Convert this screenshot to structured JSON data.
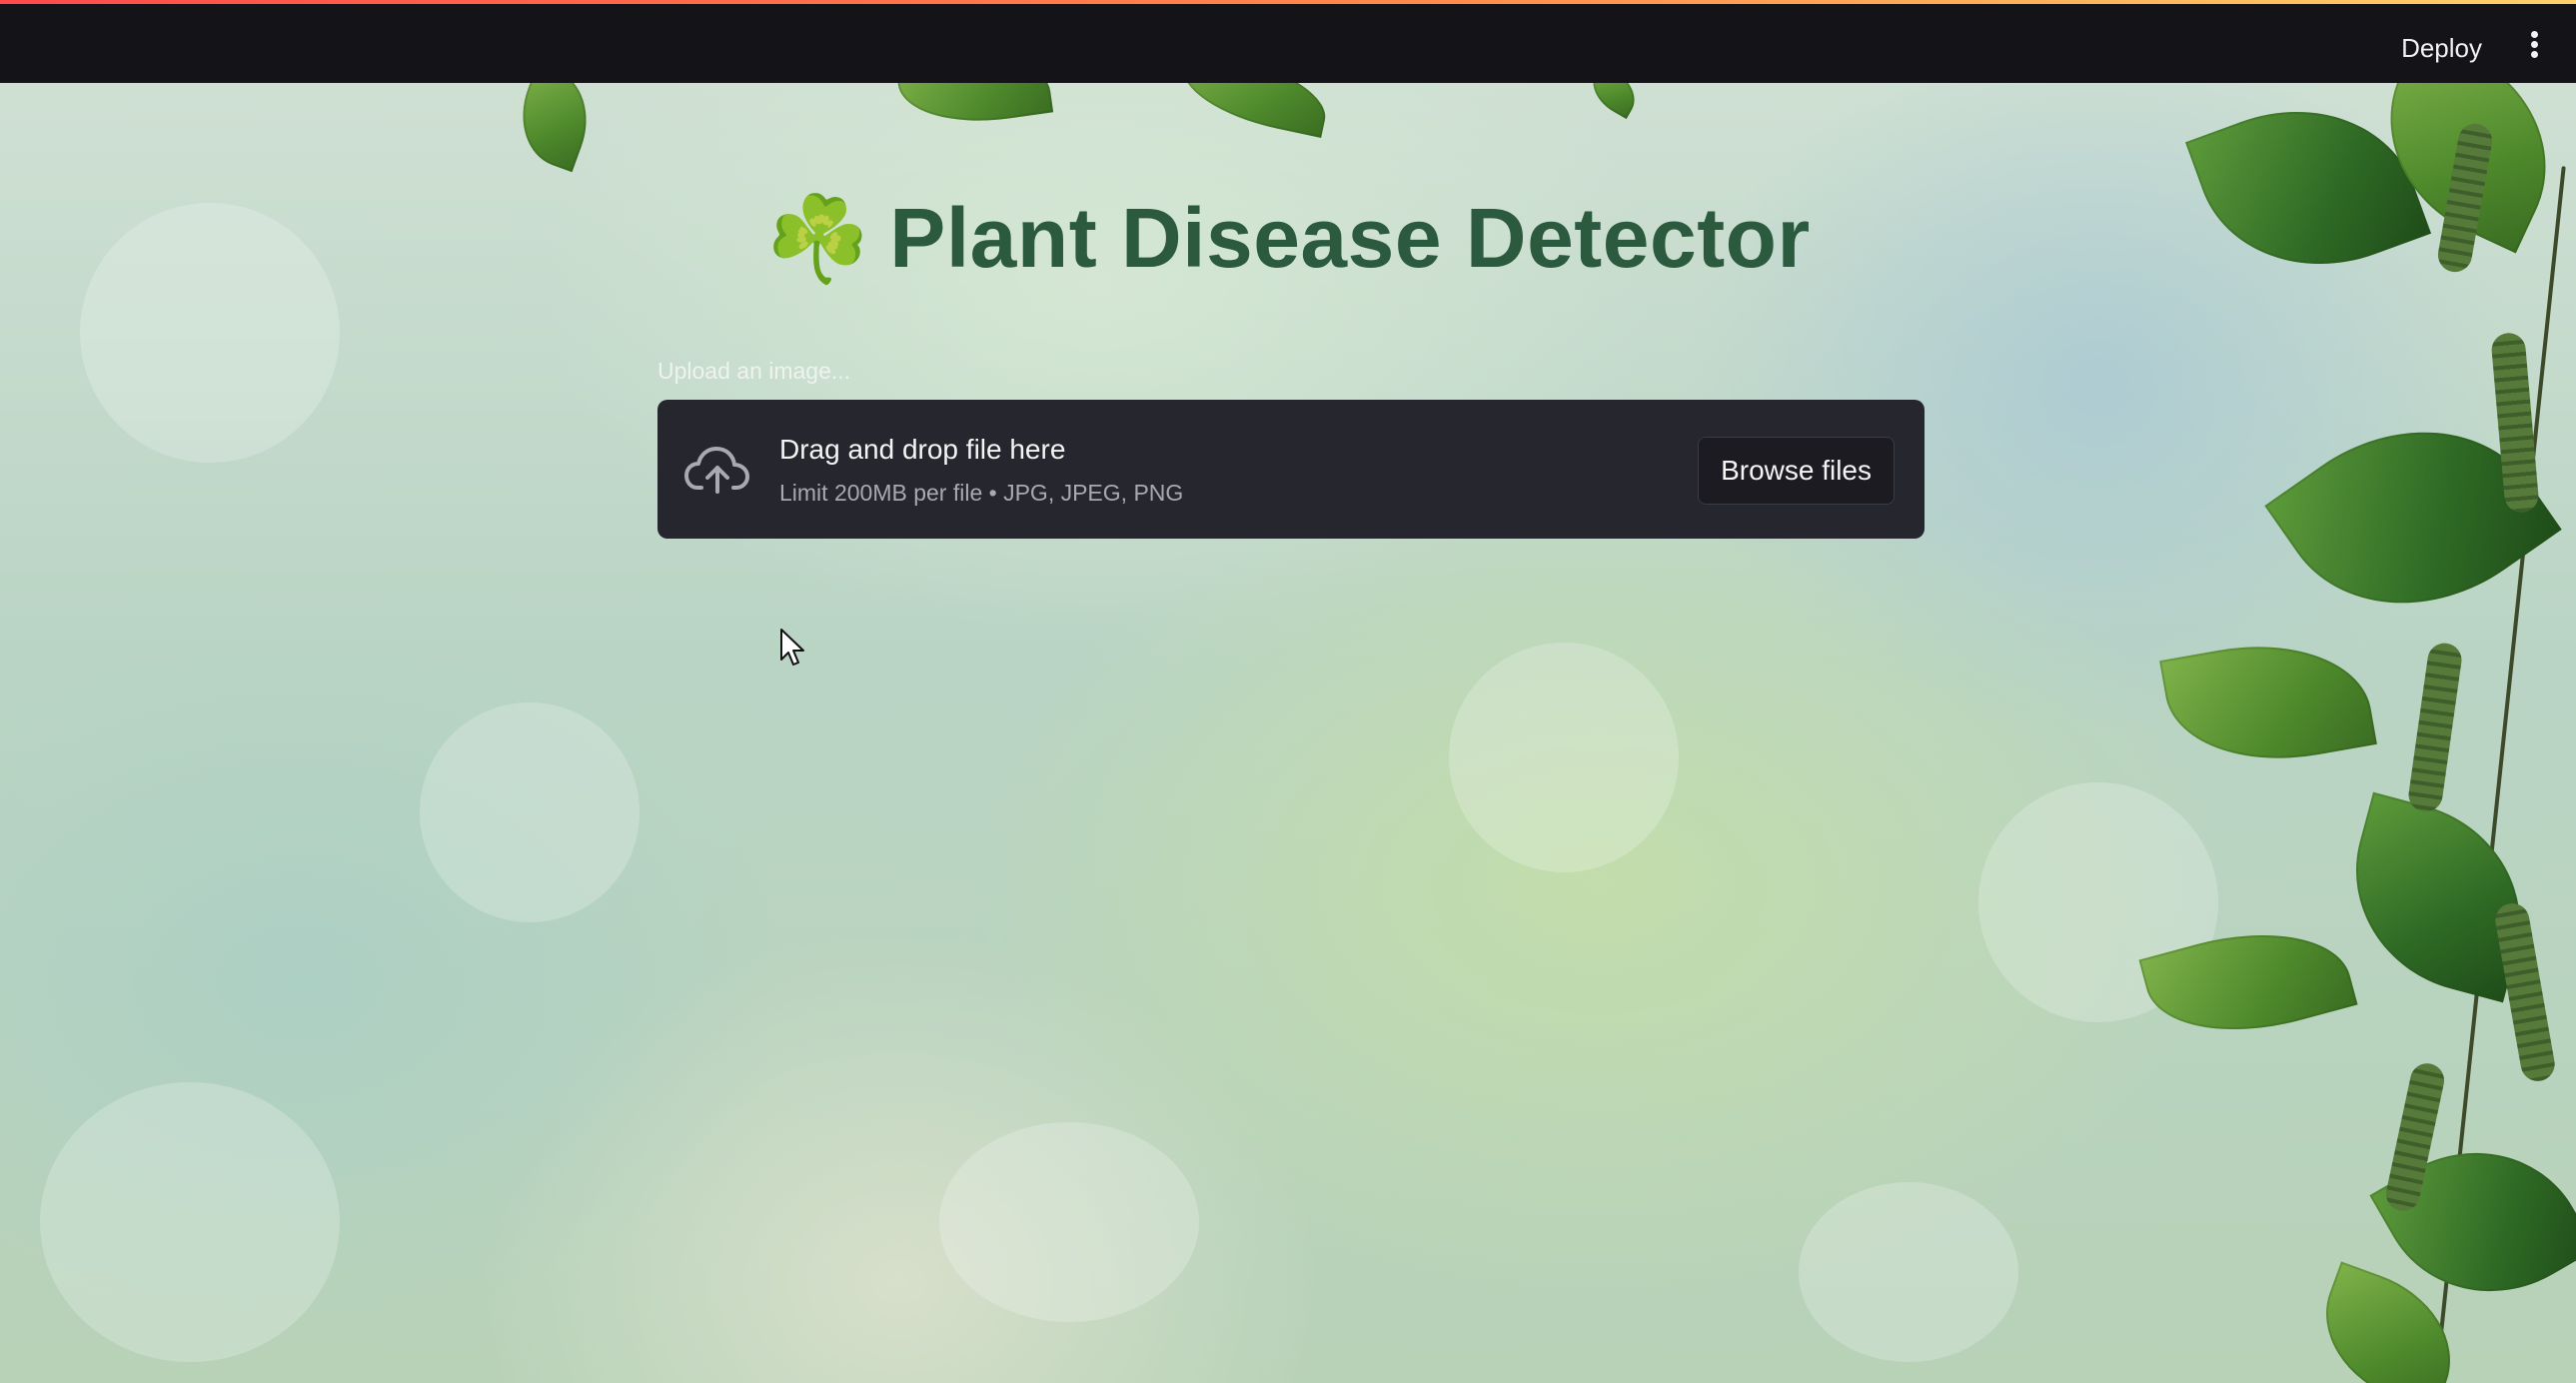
{
  "header": {
    "deploy_label": "Deploy",
    "menu_icon": "vertical-dots-icon"
  },
  "main": {
    "title_icon": "☘️",
    "title": "Plant Disease Detector",
    "uploader": {
      "label": "Upload an image...",
      "drop_text": "Drag and drop file here",
      "limit_text": "Limit 200MB per file • JPG, JPEG, PNG",
      "browse_label": "Browse files",
      "icon": "cloud-upload-icon"
    }
  },
  "colors": {
    "header_bg": "#131318",
    "title": "#2c5a3f",
    "dropzone_bg": "#26262e",
    "accent_line": "#ff4b4b"
  }
}
